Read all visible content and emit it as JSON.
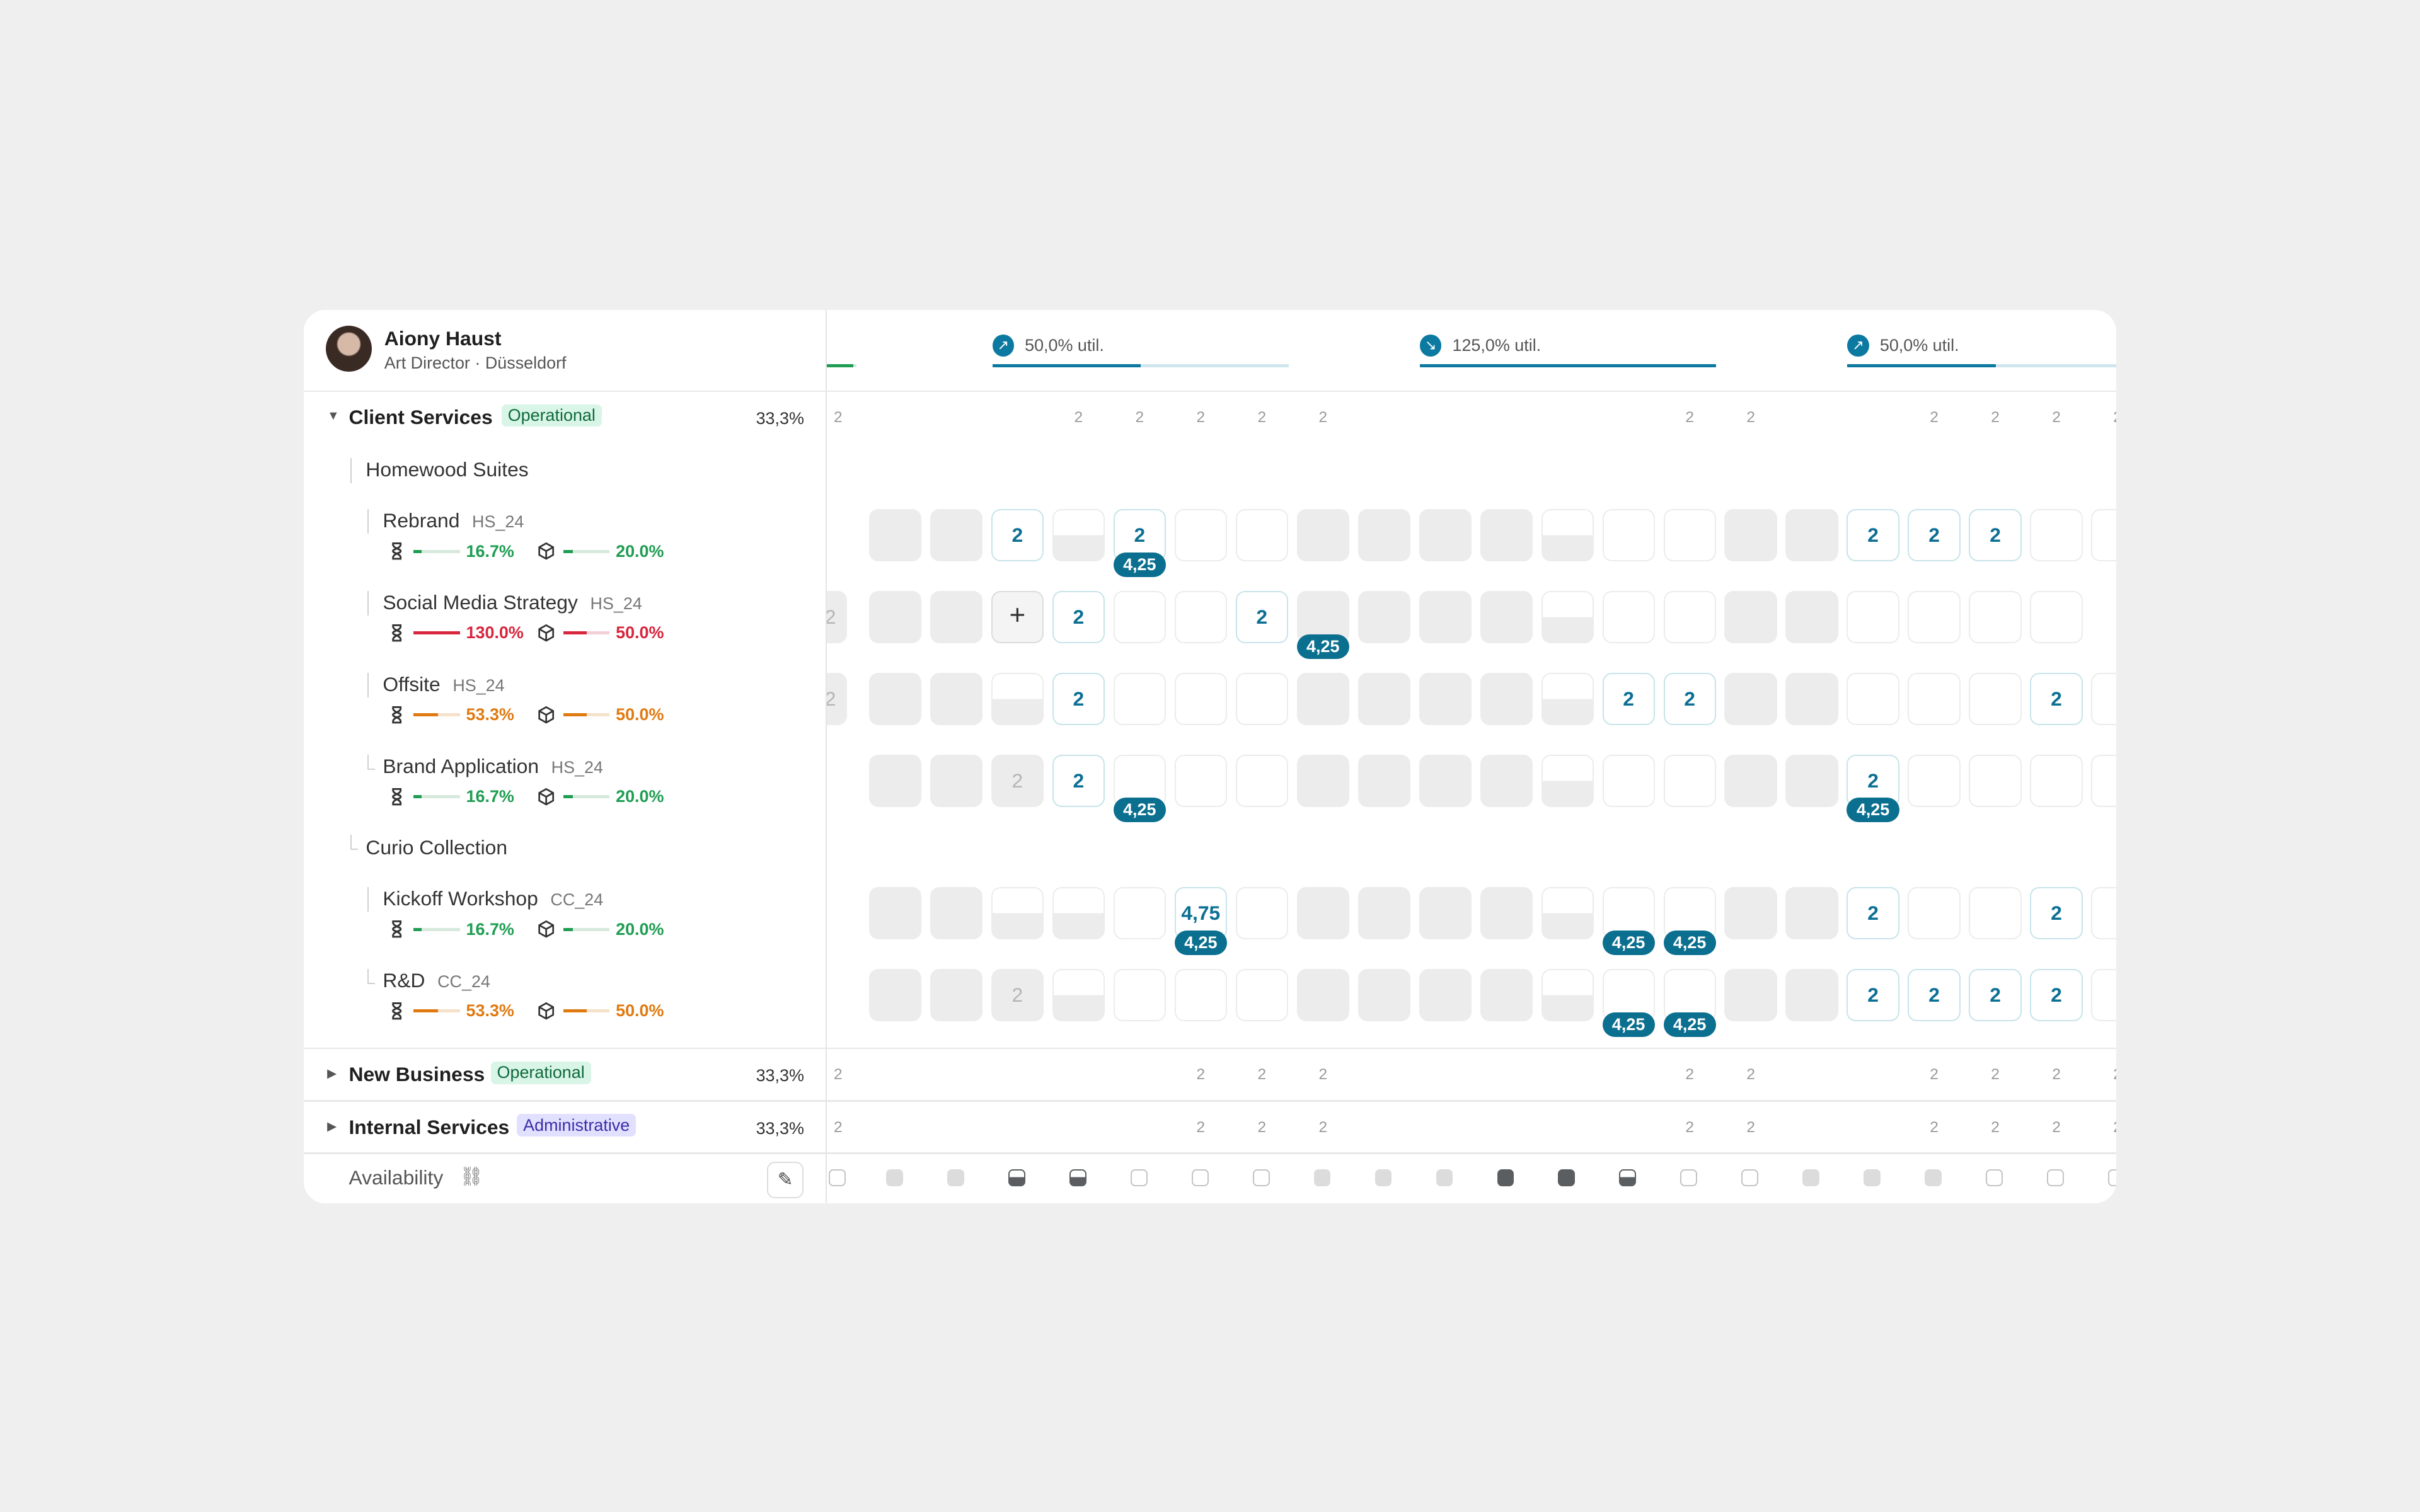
{
  "profile": {
    "name": "Aiony Haust",
    "role": "Art Director",
    "separator": "·",
    "location": "Düsseldorf"
  },
  "header": {
    "utils": [
      {
        "label": "50,0% util.",
        "direction": "up",
        "fill": 0.5
      },
      {
        "label": "125,0% util.",
        "direction": "down",
        "fill": 1.0
      },
      {
        "label": "50,0% util.",
        "direction": "up",
        "fill": 0.5
      }
    ]
  },
  "groups": {
    "client": {
      "title": "Client Services",
      "tag": "Operational",
      "pct": "33,3%"
    },
    "new": {
      "title": "New Business",
      "tag": "Operational",
      "pct": "33,3%"
    },
    "internal": {
      "title": "Internal Services",
      "tag": "Administrative",
      "pct": "33,3%"
    }
  },
  "subgroups": {
    "homewood": "Homewood Suites",
    "curio": "Curio Collection"
  },
  "projects": [
    {
      "name": "Rebrand",
      "code": "HS_24",
      "time": "16.7%",
      "budget": "20.0%",
      "status": "green"
    },
    {
      "name": "Social Media Strategy",
      "code": "HS_24",
      "time": "130.0%",
      "budget": "50.0%",
      "status": "red"
    },
    {
      "name": "Offsite",
      "code": "HS_24",
      "time": "53.3%",
      "budget": "50.0%",
      "status": "orange"
    },
    {
      "name": "Brand Application",
      "code": "HS_24",
      "time": "16.7%",
      "budget": "20.0%",
      "status": "green"
    },
    {
      "name": "Kickoff Workshop",
      "code": "CC_24",
      "time": "16.7%",
      "budget": "20.0%",
      "status": "green"
    },
    {
      "name": "R&D",
      "code": "CC_24",
      "time": "53.3%",
      "budget": "50.0%",
      "status": "orange"
    }
  ],
  "availability": {
    "label": "Availability",
    "link_icon": "link-icon",
    "pen_icon": "signature-pen-icon"
  },
  "grid": {
    "hours_label": "2",
    "cells": {
      "v2": "2",
      "v425": "4,25",
      "v475": "4,75"
    }
  },
  "colors": {
    "accent": "#0c7aa0",
    "green": "#1f9d52",
    "red": "#d7263d",
    "orange": "#e07a10"
  }
}
